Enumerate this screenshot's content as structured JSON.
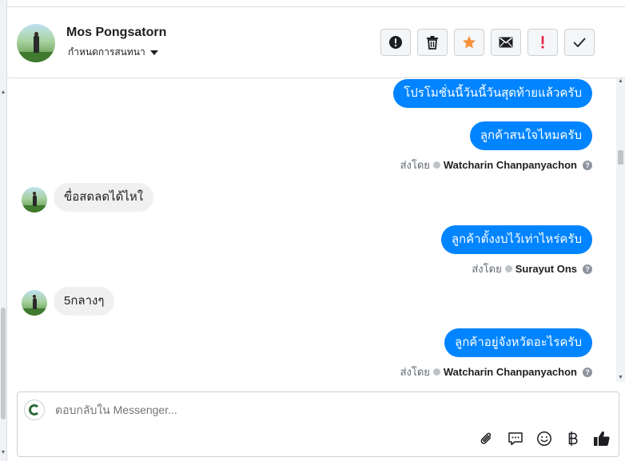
{
  "header": {
    "name": "Mos Pongsatorn",
    "subtitle": "กำหนดการสนทนา",
    "actions": [
      {
        "icon": "alert-circle-icon",
        "name": "mark-spam-button"
      },
      {
        "icon": "trash-icon",
        "name": "delete-button"
      },
      {
        "icon": "star-icon",
        "name": "star-button"
      },
      {
        "icon": "envelope-icon",
        "name": "mark-unread-button"
      },
      {
        "icon": "exclamation-icon",
        "name": "follow-up-button"
      },
      {
        "icon": "checkmark-icon",
        "name": "mark-done-button"
      }
    ]
  },
  "messages": [
    {
      "type": "out",
      "text": "โปรโมชั่นนี้วันนี้วันสุดท้ายแล้วครับ"
    },
    {
      "type": "out",
      "text": "ลูกค้าสนใจไหมครับ"
    },
    {
      "type": "sent_by",
      "prefix": "ส่งโดย",
      "name": "Watcharin Chanpanyachon"
    },
    {
      "type": "in",
      "text": "ขื่อสดลดได้ไหใ"
    },
    {
      "type": "out",
      "text": "ลูกค้าตั้งงบไว้เท่าไหร่ครับ"
    },
    {
      "type": "sent_by",
      "prefix": "ส่งโดย",
      "name": "Surayut Ons"
    },
    {
      "type": "in",
      "text": "5กลางๆ"
    },
    {
      "type": "out",
      "text": "ลูกค้าอยู่จังหวัดอะไรครับ"
    },
    {
      "type": "sent_by",
      "prefix": "ส่งโดย",
      "name": "Watcharin Chanpanyachon"
    }
  ],
  "composer": {
    "placeholder": "ตอบกลับใน Messenger...",
    "tools": [
      "paperclip-icon",
      "chat-bubble-icon",
      "emoji-icon",
      "baht-icon",
      "thumbs-up-icon"
    ]
  },
  "colors": {
    "accent": "#0084ff",
    "star": "#f7923b",
    "alert": "#e41e3f"
  }
}
